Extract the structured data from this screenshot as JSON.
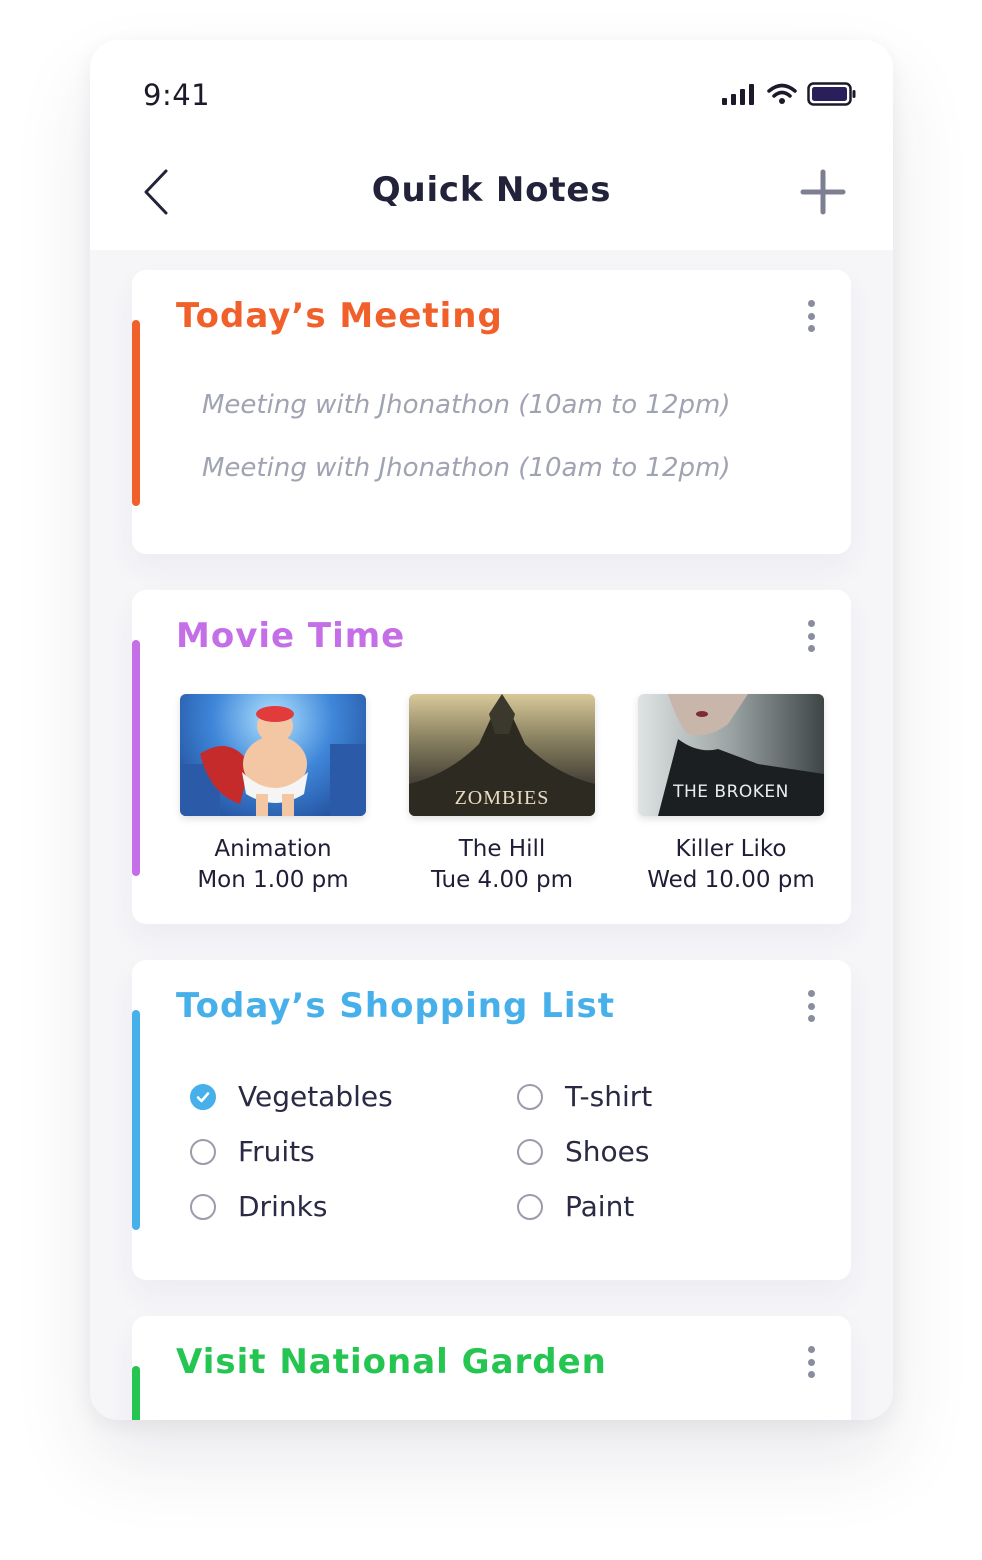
{
  "status_bar": {
    "time": "9:41"
  },
  "nav": {
    "title": "Quick Notes"
  },
  "cards": {
    "meeting": {
      "title": "Today’s Meeting",
      "color": "#f1602a",
      "lines": [
        "Meeting with Jhonathon (10am to 12pm)",
        "Meeting with Jhonathon (10am to 12pm)"
      ]
    },
    "movies": {
      "title": "Movie Time",
      "color": "#c46ee8",
      "items": [
        {
          "name": "Animation",
          "time": "Mon 1.00 pm",
          "poster_text": ""
        },
        {
          "name": "The Hill",
          "time": "Tue 4.00 pm",
          "poster_text": "ZOMBIES"
        },
        {
          "name": "Killer Liko",
          "time": "Wed 10.00 pm",
          "poster_text": "THE BROKEN"
        }
      ]
    },
    "shopping": {
      "title": "Today’s Shopping List",
      "color": "#47b0ea",
      "items": [
        {
          "label": "Vegetables",
          "checked": true
        },
        {
          "label": "Fruits",
          "checked": false
        },
        {
          "label": "Drinks",
          "checked": false
        },
        {
          "label": "T-shirt",
          "checked": false
        },
        {
          "label": "Shoes",
          "checked": false
        },
        {
          "label": "Paint",
          "checked": false
        }
      ]
    },
    "garden": {
      "title": "Visit National Garden",
      "color": "#25c552"
    }
  },
  "icons": {
    "back": "chevron-left-icon",
    "add": "plus-icon",
    "more": "more-vertical-icon",
    "signal": "signal-icon",
    "wifi": "wifi-icon",
    "battery": "battery-icon",
    "checkbox_checked": "check-circle-icon",
    "checkbox_unchecked": "circle-icon"
  }
}
